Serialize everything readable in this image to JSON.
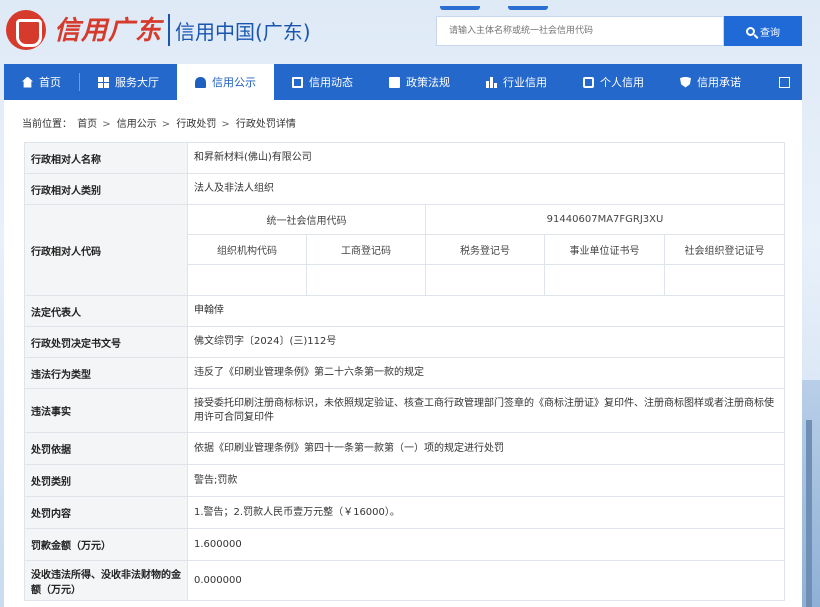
{
  "header": {
    "logo_script": "信用广东",
    "logo_title": "信用中国(广东)",
    "search_placeholder": "请输入主体名称或统一社会信用代码",
    "search_button": "查询"
  },
  "nav": {
    "items": [
      {
        "label": "首页",
        "icon": "home-icon"
      },
      {
        "label": "服务大厅",
        "icon": "grid-icon"
      },
      {
        "label": "信用公示",
        "icon": "bell-icon",
        "active": true
      },
      {
        "label": "信用动态",
        "icon": "document-icon"
      },
      {
        "label": "政策法规",
        "icon": "book-icon"
      },
      {
        "label": "行业信用",
        "icon": "bar-chart-icon"
      },
      {
        "label": "个人信用",
        "icon": "person-icon"
      },
      {
        "label": "信用承诺",
        "icon": "shield-icon"
      }
    ],
    "expand_icon": "expand-icon",
    "colors": {
      "bar": "#2568cc",
      "active_text": "#1f5fbf"
    }
  },
  "breadcrumb": {
    "prefix": "当前位置：",
    "items": [
      "首页",
      "信用公示",
      "行政处罚",
      "行政处罚详情"
    ],
    "separator": ">"
  },
  "detail": {
    "party_name_label": "行政相对人名称",
    "party_name": "和昇新材料(佛山)有限公司",
    "party_type_label": "行政相对人类别",
    "party_type": "法人及非法人组织",
    "party_code_label": "行政相对人代码",
    "uscc_label": "统一社会信用代码",
    "uscc_value": "91440607MA7FGRJ3XU",
    "code_headers": [
      "组织机构代码",
      "工商登记码",
      "税务登记号",
      "事业单位证书号",
      "社会组织登记证号"
    ],
    "legal_rep_label": "法定代表人",
    "legal_rep": "申翰倖",
    "decision_no_label": "行政处罚决定书文号",
    "decision_no": "佛文综罚字〔2024〕(三)112号",
    "violation_type_label": "违法行为类型",
    "violation_type": "违反了《印刷业管理条例》第二十六条第一款的规定",
    "violation_facts_label": "违法事实",
    "violation_facts": "接受委托印刷注册商标标识，未依照规定验证、核查工商行政管理部门签章的《商标注册证》复印件、注册商标图样或者注册商标使用许可合同复印件",
    "basis_label": "处罚依据",
    "basis": "依据《印刷业管理条例》第四十一条第一款第（一）项的规定进行处罚",
    "category_label": "处罚类别",
    "category": "警告;罚款",
    "content_label": "处罚内容",
    "content": "1.警告；2.罚款人民币壹万元整（￥16000）。",
    "fine_label": "罚款金额（万元）",
    "fine": "1.600000",
    "confiscation_label": "没收违法所得、没收非法财物的金额（万元）",
    "confiscation": "0.000000"
  }
}
